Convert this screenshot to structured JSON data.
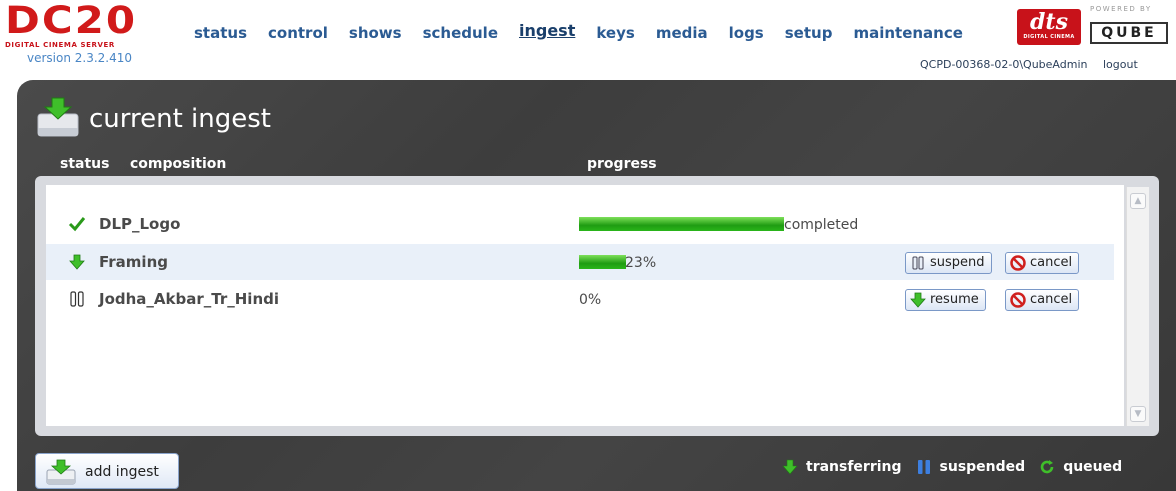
{
  "app": {
    "brand_logo": "DC20",
    "brand_subtitle": "DIGITAL CINEMA SERVER",
    "version": "version 2.3.2.410"
  },
  "nav": {
    "items": [
      {
        "label": "status"
      },
      {
        "label": "control"
      },
      {
        "label": "shows"
      },
      {
        "label": "schedule"
      },
      {
        "label": "ingest",
        "active": true
      },
      {
        "label": "keys"
      },
      {
        "label": "media"
      },
      {
        "label": "logs"
      },
      {
        "label": "setup"
      },
      {
        "label": "maintenance"
      }
    ]
  },
  "partners": {
    "dts": "dts",
    "dts_sub": "DIGITAL CINEMA",
    "powered_by": "POWERED BY",
    "qube": "QUBE"
  },
  "user": {
    "account": "QCPD-00368-02-0\\QubeAdmin",
    "logout": "logout"
  },
  "panel": {
    "title": "current ingest",
    "columns": {
      "status": "status",
      "composition": "composition",
      "progress": "progress"
    }
  },
  "ingests": [
    {
      "status": "completed-check",
      "name": "DLP_Logo",
      "progress": 100,
      "progress_text": "completed",
      "actions": []
    },
    {
      "status": "transferring",
      "name": "Framing",
      "progress": 23,
      "progress_text": "23%",
      "actions": [
        "suspend",
        "cancel"
      ]
    },
    {
      "status": "suspended",
      "name": "Jodha_Akbar_Tr_Hindi",
      "progress": 0,
      "progress_text": "0%",
      "actions": [
        "resume",
        "cancel"
      ]
    }
  ],
  "buttons": {
    "suspend": "suspend",
    "cancel": "cancel",
    "resume": "resume",
    "add_ingest": "add ingest"
  },
  "legend": {
    "transferring": "transferring",
    "suspended": "suspended",
    "queued": "queued"
  },
  "colors": {
    "accent_red": "#d11a1a",
    "nav_blue": "#2b5b93",
    "progress_green": "#1f9c12"
  }
}
